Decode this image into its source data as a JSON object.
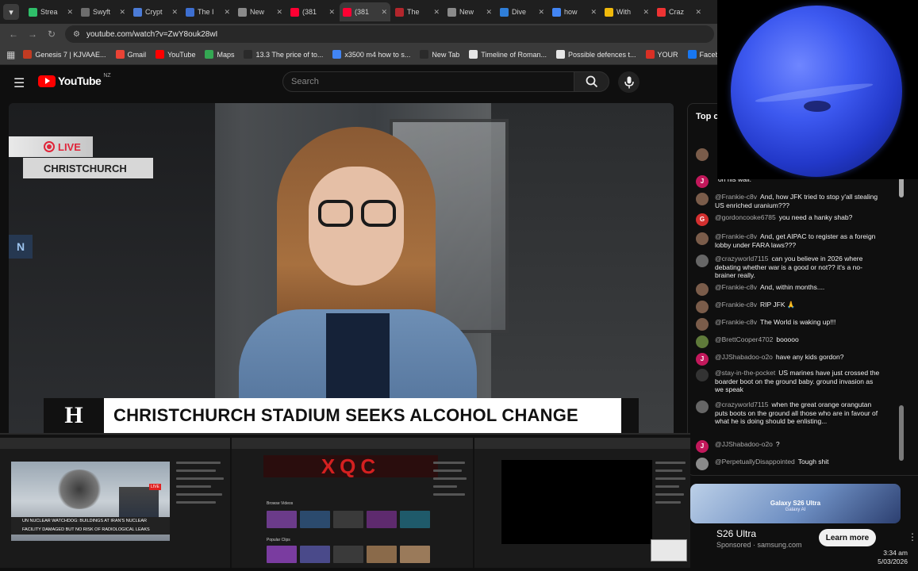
{
  "tabs": [
    {
      "label": "Strea",
      "color": "#2fbf6a",
      "active": false
    },
    {
      "label": "Swyft",
      "color": "#6d6d6d",
      "active": false
    },
    {
      "label": "Crypt",
      "color": "#4b7bd6",
      "active": false
    },
    {
      "label": "The I",
      "color": "#3d6fd1",
      "active": false
    },
    {
      "label": "New",
      "color": "#8a8a8a",
      "active": false
    },
    {
      "label": "(381",
      "color": "#ff0033",
      "active": false
    },
    {
      "label": "(381",
      "color": "#ff0033",
      "active": true
    },
    {
      "label": "The",
      "color": "#b3262c",
      "active": false
    },
    {
      "label": "New",
      "color": "#8a8a8a",
      "active": false
    },
    {
      "label": "Dive",
      "color": "#2f7ed8",
      "active": false
    },
    {
      "label": "how",
      "color": "#4285f4",
      "active": false
    },
    {
      "label": "With",
      "color": "#f0b90b",
      "active": false
    },
    {
      "label": "Craz",
      "color": "#e33",
      "active": false
    }
  ],
  "address": {
    "url": "youtube.com/watch?v=ZwY8ouk28wI"
  },
  "bookmarks": [
    {
      "label": "Genesis 7 | KJVAAE...",
      "color": "#c23b22"
    },
    {
      "label": "Gmail",
      "color": "#ea4335"
    },
    {
      "label": "YouTube",
      "color": "#ff0000"
    },
    {
      "label": "Maps",
      "color": "#34a853"
    },
    {
      "label": "13.3 The price of to...",
      "color": "#2a2a2a"
    },
    {
      "label": "x3500 m4 how to s...",
      "color": "#4285f4"
    },
    {
      "label": "New Tab",
      "color": "#2a2a2a"
    },
    {
      "label": "Timeline of Roman...",
      "color": "#e6e6e6"
    },
    {
      "label": "Possible defences t...",
      "color": "#e6e6e6"
    },
    {
      "label": "YOUR",
      "color": "#d93025"
    },
    {
      "label": "Facebook green",
      "color": "#1877f2"
    }
  ],
  "youtube": {
    "logo": "YouTube",
    "region": "NZ",
    "search_placeholder": "Search"
  },
  "video": {
    "live_label": "LIVE",
    "location": "CHRISTCHURCH",
    "headline": "CHRISTCHURCH STADIUM SEEKS ALCOHOL CHANGE",
    "channel_mark": "H"
  },
  "chat": {
    "title": "Top c",
    "messages": [
      {
        "author": "",
        "text": "",
        "avatar_color": "#7a5c4a",
        "initial": ""
      },
      {
        "author": "",
        "text": "on his wall.",
        "avatar_color": "#c2185b",
        "initial": "J"
      },
      {
        "author": "@Frankie-c8v",
        "text": "And, how JFK tried to stop y'all stealing US enriched uranium???",
        "avatar_color": "#7a5c4a",
        "initial": ""
      },
      {
        "author": "@gordoncooke6785",
        "text": "you need a hanky shab?",
        "avatar_color": "#d32f2f",
        "initial": "G"
      },
      {
        "author": "@Frankie-c8v",
        "text": "And, get AIPAC to register as a foreign lobby under FARA laws???",
        "avatar_color": "#7a5c4a",
        "initial": ""
      },
      {
        "author": "@crazyworld7115",
        "text": "can you believe in 2026 where debating whether war is a good or not?? it's a no-brainer really.",
        "avatar_color": "#666",
        "initial": ""
      },
      {
        "author": "@Frankie-c8v",
        "text": "And, within months....",
        "avatar_color": "#7a5c4a",
        "initial": ""
      },
      {
        "author": "@Frankie-c8v",
        "text": "RIP JFK 🙏",
        "avatar_color": "#7a5c4a",
        "initial": ""
      },
      {
        "author": "@Frankie-c8v",
        "text": "The World is waking up!!!",
        "avatar_color": "#7a5c4a",
        "initial": ""
      },
      {
        "author": "@BrettCooper4702",
        "text": "booooo",
        "avatar_color": "#5f7a3a",
        "initial": ""
      },
      {
        "author": "@JJShabadoo-o2o",
        "text": "have any kids gordon?",
        "avatar_color": "#c2185b",
        "initial": "J"
      },
      {
        "author": "@stay-in-the-pocket",
        "text": "US marines have just crossed the boarder boot on the ground baby. ground invasion as we speak",
        "avatar_color": "#333",
        "initial": ""
      },
      {
        "author": "@crazyworld7115",
        "text": "when the great orange orangutan puts boots on the ground all those who are in favour of what he is doing should be enlisting...",
        "avatar_color": "#666",
        "initial": ""
      },
      {
        "author": "@JJShabadoo-o2o",
        "text": "?",
        "avatar_color": "#c2185b",
        "initial": "J"
      },
      {
        "author": "@PerpetuallyDisappointed",
        "text": "Tough shit",
        "avatar_color": "#8a8a8a",
        "initial": ""
      }
    ]
  },
  "ad": {
    "image_title": "Galaxy S26 Ultra",
    "image_sub": "Galaxy AI",
    "title": "S26 Ultra",
    "sponsored": "Sponsored · samsung.com",
    "cta": "Learn more"
  },
  "thumbnails": {
    "thumb1_ticker1": "UN NUCLEAR WATCHDOG: BUILDINGS AT IRAN'S NUCLEAR",
    "thumb1_ticker2": "FACILITY DAMAGED BUT NO RISK OF RADIOLOGICAL LEAKS",
    "thumb1_live": "LIVE",
    "thumb2_banner": "XQC",
    "thumb2_label1": "Browse Videos",
    "thumb2_label2": "Popular Clips"
  },
  "clock": {
    "time": "3:34 am",
    "date": "5/03/2026"
  }
}
